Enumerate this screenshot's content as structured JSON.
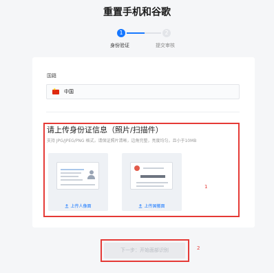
{
  "page": {
    "title": "重置手机和谷歌"
  },
  "stepper": {
    "steps": [
      {
        "number": "1",
        "label": "身份验证",
        "state": "active"
      },
      {
        "number": "2",
        "label": "提交审核",
        "state": "inactive"
      }
    ]
  },
  "form": {
    "country_label": "国籍",
    "country_value": "中国",
    "country_flag": "china-flag-icon"
  },
  "upload": {
    "title": "请上传身份证信息（照片/扫描件）",
    "hint": "支持 JPG/JPEG/PNG 格式，请保证照片清晰，边角完整，亮度均匀，且小于10MB",
    "front_action": "上传人像面",
    "back_action": "上传国徽面",
    "upload_icon": "upload-icon"
  },
  "annotations": {
    "one": "1",
    "two": "2"
  },
  "actions": {
    "next_label": "下一步：开始面部识别"
  },
  "colors": {
    "accent": "#1677ff",
    "annotation": "#e53935",
    "disabled_bg": "#e9eaed",
    "disabled_text": "#b8bcc3"
  }
}
